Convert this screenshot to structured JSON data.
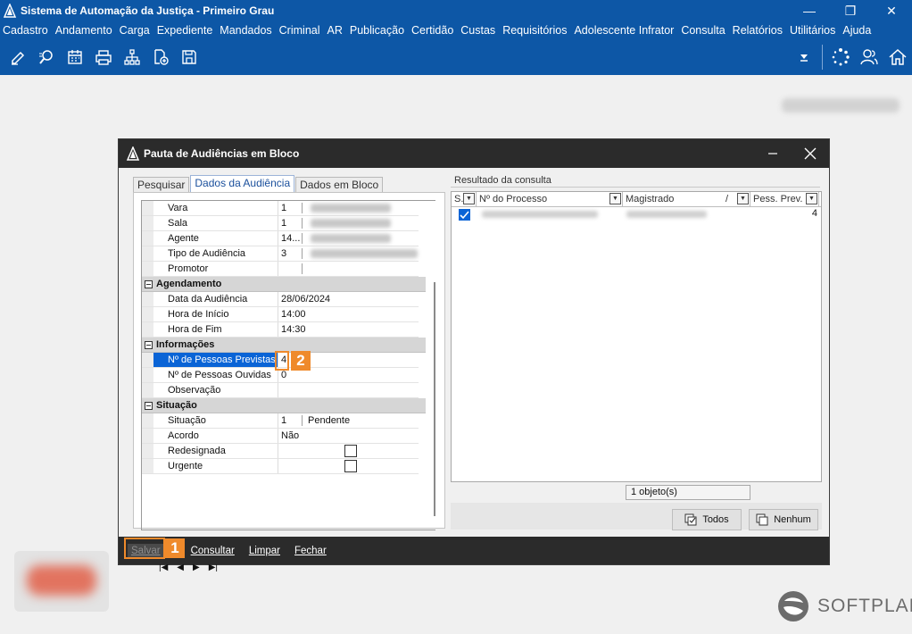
{
  "app": {
    "title": "Sistema de Automação da Justiça - Primeiro Grau",
    "window_buttons": [
      "—",
      "❐",
      "✕"
    ]
  },
  "menu": [
    "Cadastro",
    "Andamento",
    "Carga",
    "Expediente",
    "Mandados",
    "Criminal",
    "AR",
    "Publicação",
    "Certidão",
    "Custas",
    "Requisitórios",
    "Adolescente Infrator",
    "Consulta",
    "Relatórios",
    "Utilitários",
    "Ajuda"
  ],
  "toolbar": {
    "left_icons": [
      "edit-icon",
      "search-process-icon",
      "calendar-icon",
      "printer-icon",
      "hierarchy-icon",
      "add-document-icon",
      "folder-icon"
    ],
    "right_icons": [
      "dropdown-arrow-icon",
      "loading-icon",
      "users-icon",
      "home-icon"
    ]
  },
  "dialog": {
    "title": "Pauta de Audiências em Bloco",
    "tabs": [
      "Pesquisar",
      "Dados da Audiência",
      "Dados em Bloco"
    ],
    "active_tab": 1,
    "rows": [
      {
        "label": "Vara",
        "value": "1"
      },
      {
        "label": "Sala",
        "value": "1"
      },
      {
        "label": "Agente",
        "value": "14..."
      },
      {
        "label": "Tipo de Audiência",
        "value": "3"
      },
      {
        "label": "Promotor",
        "value": ""
      }
    ],
    "sections": {
      "agendamento": {
        "title": "Agendamento",
        "rows": [
          {
            "label": "Data da Audiência",
            "value": "28/06/2024"
          },
          {
            "label": "Hora de Início",
            "value": "14:00"
          },
          {
            "label": "Hora de Fim",
            "value": "14:30"
          }
        ]
      },
      "informacoes": {
        "title": "Informações",
        "rows": [
          {
            "label": "Nº de Pessoas Previstas",
            "value": "4"
          },
          {
            "label": "Nº de Pessoas Ouvidas",
            "value": "0"
          },
          {
            "label": "Observação",
            "value": ""
          }
        ]
      },
      "situacao": {
        "title": "Situação",
        "rows": [
          {
            "label": "Situação",
            "value": "1",
            "extra": "Pendente"
          },
          {
            "label": "Acordo",
            "value": "Não"
          },
          {
            "label": "Redesignada",
            "value": ""
          },
          {
            "label": "Urgente",
            "value": ""
          }
        ]
      }
    },
    "nav_buttons": [
      "|◀",
      "◀",
      "▶",
      "▶|"
    ],
    "result": {
      "caption": "Resultado da consulta",
      "columns": [
        "S.",
        "Nº do Processo",
        "Magistrado",
        "Pess. Prev."
      ],
      "row_value": "4",
      "count": "1 objeto(s)",
      "btn_all": "Todos",
      "btn_none": "Nenhum"
    },
    "footer": [
      "Salvar",
      "Consultar",
      "Limpar",
      "Fechar"
    ],
    "callouts": [
      "1",
      "2"
    ]
  },
  "brand": "SOFTPLAN",
  "colors": {
    "accent": "#0d57a6",
    "dark": "#2b2b2b",
    "callout": "#ef8a2b",
    "selection": "#0a64d6"
  }
}
